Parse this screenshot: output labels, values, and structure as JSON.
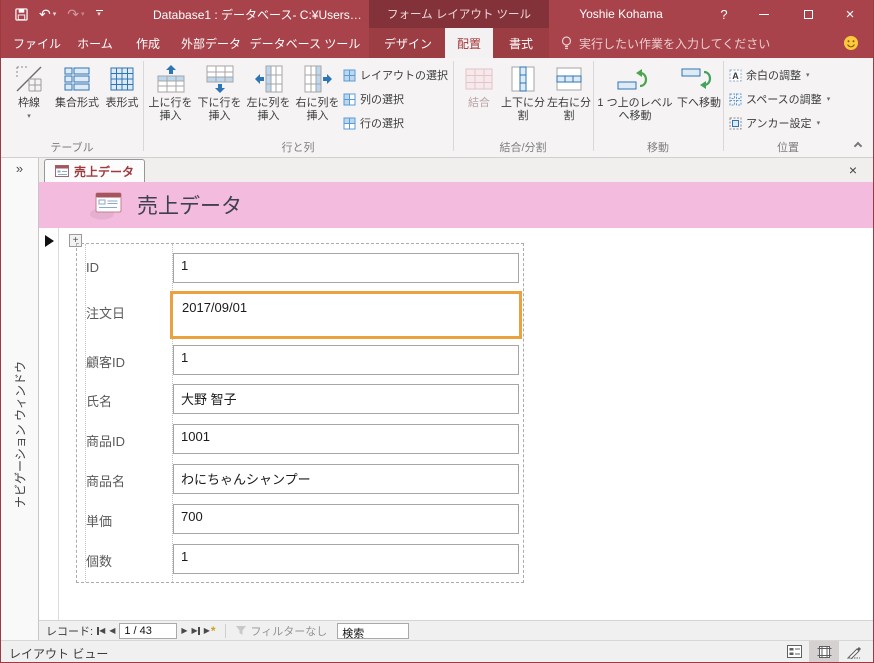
{
  "title_bar": {
    "title": "Database1 : データベース- C:¥Users…",
    "contextual_title": "フォーム レイアウト ツール",
    "user_name": "Yoshie Kohama",
    "help_glyph": "?",
    "close_glyph": "×"
  },
  "ribbon": {
    "tabs": [
      "ファイル",
      "ホーム",
      "作成",
      "外部データ",
      "データベース ツール"
    ],
    "contextual_tabs": [
      "デザイン",
      "配置",
      "書式"
    ],
    "tell_me": "実行したい作業を入力してください",
    "groups": {
      "table": {
        "label": "テーブル",
        "buttons": [
          "枠線",
          "集合形式",
          "表形式"
        ]
      },
      "rows_cols": {
        "label": "行と列",
        "big_buttons": [
          "上に行を挿入",
          "下に行を挿入",
          "左に列を挿入",
          "右に列を挿入"
        ],
        "small_buttons": [
          "レイアウトの選択",
          "列の選択",
          "行の選択"
        ]
      },
      "merge_split": {
        "label": "結合/分割",
        "buttons": [
          "結合",
          "上下に分割",
          "左右に分割"
        ]
      },
      "move": {
        "label": "移動",
        "buttons": [
          "1 つ上のレベルへ移動",
          "下へ移動"
        ]
      },
      "position": {
        "label": "位置",
        "buttons": [
          "余白の調整",
          "スペースの調整",
          "アンカー設定"
        ]
      }
    }
  },
  "nav_pane": {
    "expand_glyph": "»",
    "vertical_label": "ナビゲーション ウィンドウ"
  },
  "document": {
    "tab_label": "売上データ",
    "close_glyph": "×",
    "header_title": "売上データ"
  },
  "form": {
    "fields": [
      {
        "label": "ID",
        "value": "1"
      },
      {
        "label": "注文日",
        "value": "2017/09/01"
      },
      {
        "label": "顧客ID",
        "value": "1"
      },
      {
        "label": "氏名",
        "value": "大野 智子"
      },
      {
        "label": "商品ID",
        "value": "1001"
      },
      {
        "label": "商品名",
        "value": "わにちゃんシャンプー"
      },
      {
        "label": "単価",
        "value": "700"
      },
      {
        "label": "個数",
        "value": "1"
      }
    ]
  },
  "record_nav": {
    "record_label": "レコード:",
    "position": "1 / 43",
    "filter_label": "フィルターなし",
    "search_text": "検索"
  },
  "status_bar": {
    "view_label": "レイアウト ビュー"
  },
  "colors": {
    "titlebar_red": "#A8434B",
    "contextual_dark_red": "#84323A",
    "header_pink": "#F3BBDD",
    "selection_orange": "#EBA23E"
  }
}
